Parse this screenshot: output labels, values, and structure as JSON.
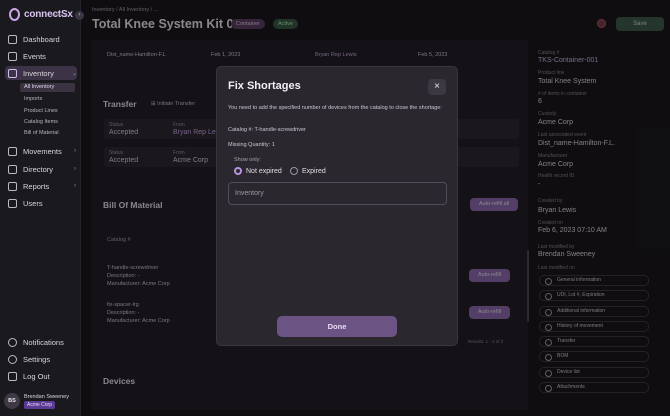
{
  "app": {
    "logo_text": "connectSx",
    "logo_sub": "ART OF SX"
  },
  "sidebar": {
    "items": [
      {
        "label": "Dashboard"
      },
      {
        "label": "Events"
      },
      {
        "label": "Inventory"
      },
      {
        "label": "Movements"
      },
      {
        "label": "Directory"
      },
      {
        "label": "Reports"
      },
      {
        "label": "Users"
      }
    ],
    "sub_items": [
      "All Inventory",
      "Imports",
      "Product Lines",
      "Catalog Items",
      "Bill of Material"
    ],
    "bottom": [
      {
        "label": "Notifications"
      },
      {
        "label": "Settings"
      },
      {
        "label": "Log Out"
      }
    ],
    "user": {
      "initials": "BS",
      "name": "Brendan Sweeney",
      "org": "Acme Corp"
    }
  },
  "header": {
    "breadcrumb": "Inventory  /  All Inventory  /  ...",
    "title": "Total Knee System Kit 001",
    "badge_type": "Container",
    "badge_status": "Active",
    "save_label": "Save"
  },
  "main": {
    "top_row": {
      "name": "Dist_name-Hamilton-F.L",
      "date1": "Feb 1, 2023",
      "rep": "Bryan Rep Lewis",
      "date2": "Feb 5, 2023"
    },
    "transfer": {
      "title": "Transfer",
      "initiate_label": "Initiate Transfer",
      "rows": [
        {
          "status_label": "Status",
          "status": "Accepted",
          "from_label": "From",
          "from": "Bryan Rep Le"
        },
        {
          "status_label": "Status",
          "status": "Accepted",
          "from_label": "From",
          "from": "Acme Corp"
        }
      ]
    },
    "bom": {
      "title": "Bill Of Material",
      "refill_all_label": "Auto-refill all",
      "catalog_header": "Catalog #",
      "items": [
        {
          "catalog": "T-handle-screwdriver",
          "description": "Description: -",
          "manufacturer": "Manufacturer: Acme Corp",
          "refill_label": "Auto-refill"
        },
        {
          "catalog": "fix-spacer-lrg",
          "description": "Description: -",
          "manufacturer": "Manufacturer: Acme Corp",
          "refill_label": "Auto-refill"
        }
      ],
      "results": "Results: 1 - 2 of 2"
    },
    "devices_title": "Devices"
  },
  "panel": {
    "fields": [
      {
        "label": "Catalog #",
        "value": "TKS-Container-001",
        "accent": true
      },
      {
        "label": "Product line",
        "value": "Total Knee System"
      },
      {
        "label": "# of items in container",
        "value": "6"
      },
      {
        "label": "Custody",
        "value": "Acme Corp"
      },
      {
        "label": "Last associated event",
        "value": "Dist_name-Hamilton-F.L."
      },
      {
        "label": "Manufacturer",
        "value": "Acme Corp"
      },
      {
        "label": "Health record ID",
        "value": "-"
      },
      {
        "label": "Created by",
        "value": "Bryan Lewis"
      },
      {
        "label": "Created on",
        "value": "Feb 6, 2023 07:10 AM"
      },
      {
        "label": "Last modified by",
        "value": "Brendan Sweeney"
      }
    ],
    "last_modified_on_label": "Last modified on",
    "links": [
      "General information",
      "UDI, Lot #, Expiration",
      "Additional information",
      "History of movement",
      "Transfer",
      "BOM",
      "Device list",
      "Attachments"
    ]
  },
  "modal": {
    "title": "Fix Shortages",
    "description": "You need to add the specified number of devices from the catalog to close the shortage:",
    "catalog_line": "Catalog #: T-handle-screwdriver",
    "missing_line": "Missing Quantity: 1",
    "show_only_label": "Show only:",
    "option_not_expired": "Not expired",
    "option_expired": "Expired",
    "input_placeholder": "Inventory",
    "done_label": "Done"
  }
}
